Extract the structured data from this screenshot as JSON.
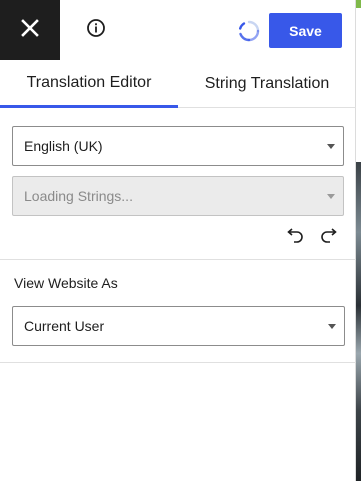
{
  "header": {
    "close_icon": "close-icon",
    "info_icon": "info-icon",
    "spinner_icon": "loading-spinner-icon",
    "save_label": "Save",
    "accent_color": "#3858e9"
  },
  "tabs": [
    {
      "label": "Translation Editor",
      "active": true
    },
    {
      "label": "String Translation",
      "active": false
    }
  ],
  "language_select": {
    "value": "English (UK)"
  },
  "strings_select": {
    "value": "Loading Strings...",
    "disabled": true
  },
  "history": {
    "undo_icon": "undo-icon",
    "redo_icon": "redo-icon"
  },
  "view_as": {
    "label": "View Website As",
    "value": "Current User"
  }
}
